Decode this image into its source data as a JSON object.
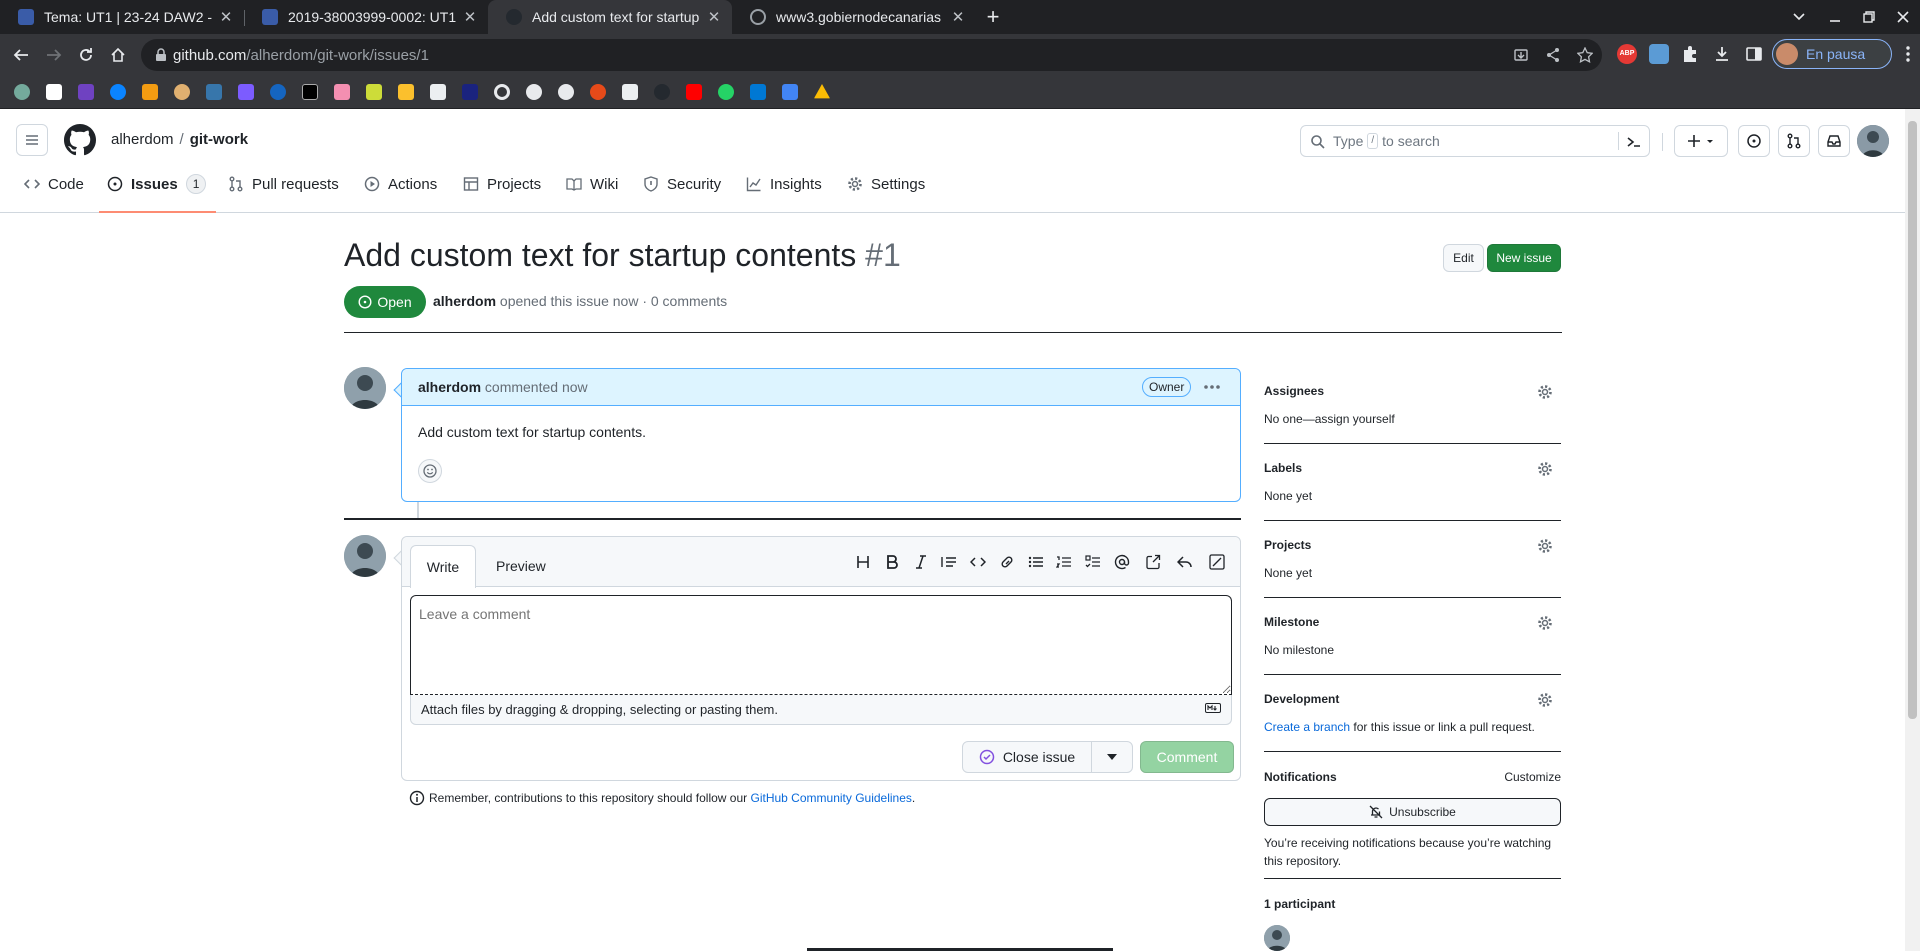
{
  "browser": {
    "tabs": [
      {
        "title": "Tema: UT1 | 23-24 DAW2 -",
        "favicon_color": "#3a5ca8"
      },
      {
        "title": "2019-38003999-0002: UT1",
        "favicon_color": "#3a5ca8"
      },
      {
        "title": "Add custom text for startup",
        "favicon_color": "#24292f"
      },
      {
        "title": "www3.gobiernodecanarias",
        "favicon_color": "#5f6368"
      }
    ],
    "close_glyph": "✕",
    "new_tab_glyph": "+",
    "url_host": "github.com",
    "url_path": "/alherdom/git-work/issues/1",
    "profile_label": "En pausa"
  },
  "github": {
    "owner": "alherdom",
    "separator": "/",
    "repo": "git-work",
    "search_prefix": "Type",
    "search_kbd": "/",
    "search_suffix": "to search",
    "nav": [
      {
        "label": "Code",
        "icon": "code-icon"
      },
      {
        "label": "Issues",
        "icon": "issue-opened-icon",
        "count": "1"
      },
      {
        "label": "Pull requests",
        "icon": "git-pull-request-icon"
      },
      {
        "label": "Actions",
        "icon": "play-icon"
      },
      {
        "label": "Projects",
        "icon": "table-icon"
      },
      {
        "label": "Wiki",
        "icon": "book-icon"
      },
      {
        "label": "Security",
        "icon": "shield-icon"
      },
      {
        "label": "Insights",
        "icon": "graph-icon"
      },
      {
        "label": "Settings",
        "icon": "gear-icon"
      }
    ]
  },
  "issue": {
    "title": "Add custom text for startup contents",
    "number": "#1",
    "edit_label": "Edit",
    "new_issue_label": "New issue",
    "state": "Open",
    "author": "alherdom",
    "meta_text": "opened this issue now · 0 comments",
    "comment": {
      "author": "alherdom",
      "time_text": "commented now",
      "badge": "Owner",
      "body": "Add custom text for startup contents."
    },
    "editor": {
      "tab_write": "Write",
      "tab_preview": "Preview",
      "placeholder": "Leave a comment",
      "attach_text": "Attach files by dragging & dropping, selecting or pasting them.",
      "close_label": "Close issue",
      "comment_label": "Comment"
    },
    "remember_prefix": "Remember, contributions to this repository should follow our",
    "remember_link": "GitHub Community Guidelines",
    "remember_suffix": "."
  },
  "sidebar": {
    "assignees_title": "Assignees",
    "assignees_value": "No one—assign yourself",
    "labels_title": "Labels",
    "labels_value": "None yet",
    "projects_title": "Projects",
    "projects_value": "None yet",
    "milestone_title": "Milestone",
    "milestone_value": "No milestone",
    "development_title": "Development",
    "development_link": "Create a branch",
    "development_text": "for this issue or link a pull request.",
    "notifications_title": "Notifications",
    "notifications_customize": "Customize",
    "unsubscribe_label": "Unsubscribe",
    "notifications_text": "You’re receiving notifications because you’re watching this repository.",
    "participants": "1 participant"
  },
  "colors": {
    "accent_green": "#1f883d",
    "link_blue": "#0969da",
    "tab_underline": "#fd8c73"
  }
}
